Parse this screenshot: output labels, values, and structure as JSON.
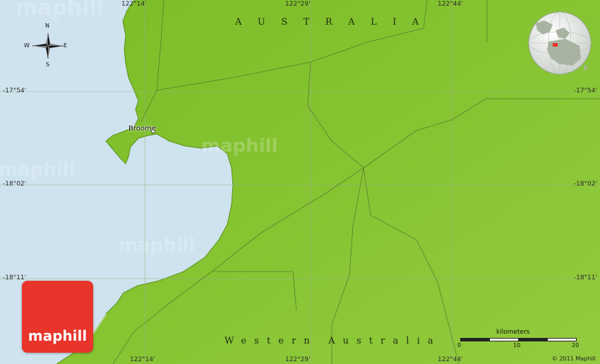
{
  "map": {
    "country": "AUSTRALIA",
    "region": "Western Australia",
    "city": "Broome",
    "coordinates": {
      "top": [
        "122°14'",
        "122°29'",
        "122°44'"
      ],
      "bottom": [
        "122°14'",
        "122°29'",
        "122°44'"
      ],
      "left": [
        "-17°54'",
        "-18°02'",
        "-18°11'"
      ],
      "right": [
        "-17°54'",
        "-18°02'",
        "-18°11'"
      ]
    },
    "compass": {
      "north": "N",
      "south": "S",
      "east": "E",
      "west": "W"
    },
    "scale": {
      "title": "kilometers",
      "ticks": [
        "0",
        "10",
        "20"
      ]
    },
    "watermark": "maphill",
    "logo_text": "maphill",
    "copyright": "© 2011 Maphill",
    "colors": {
      "land": "#7fbf2a",
      "water": "#cfe3ee",
      "logo": "#e8342a"
    }
  }
}
